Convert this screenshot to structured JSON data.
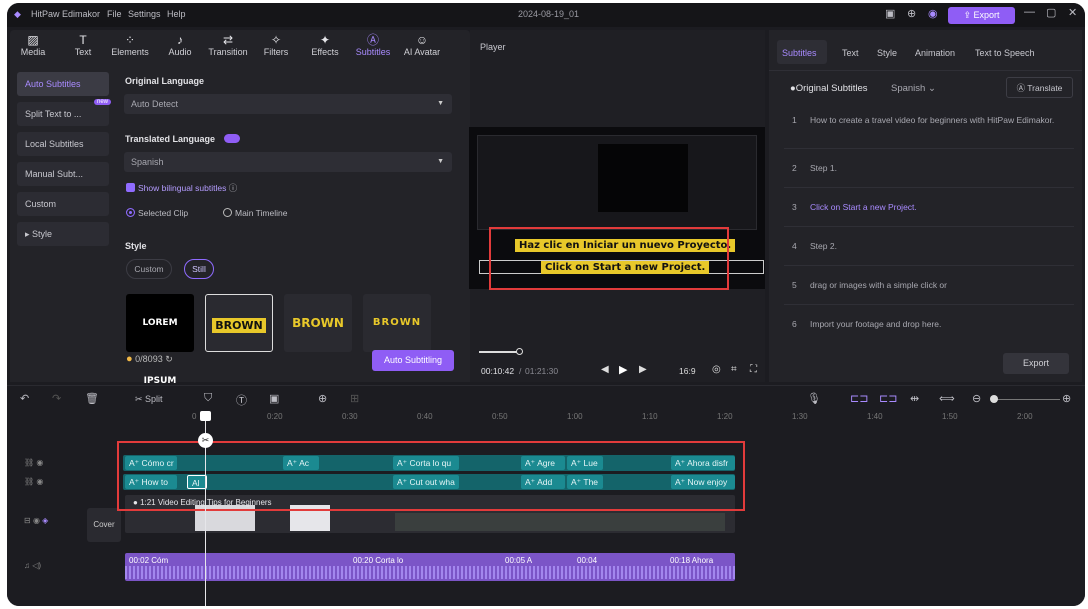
{
  "app": {
    "name": "HitPaw Edimakor",
    "menus": [
      "File",
      "Settings",
      "Help"
    ],
    "project_title": "2024-08-19_01",
    "export_label": "Export"
  },
  "toolbar": [
    {
      "label": "Media",
      "icon": "media-icon"
    },
    {
      "label": "Text",
      "icon": "text-icon"
    },
    {
      "label": "Elements",
      "icon": "elements-icon"
    },
    {
      "label": "Audio",
      "icon": "audio-icon"
    },
    {
      "label": "Transition",
      "icon": "transition-icon"
    },
    {
      "label": "Filters",
      "icon": "filters-icon"
    },
    {
      "label": "Effects",
      "icon": "effects-icon"
    },
    {
      "label": "Subtitles",
      "icon": "subtitles-icon",
      "active": true
    },
    {
      "label": "AI Avatar",
      "icon": "ai-avatar-icon"
    }
  ],
  "sidenav": {
    "items": [
      "Auto Subtitles",
      "Split Text to ...",
      "Local Subtitles",
      "Manual Subt...",
      "Custom",
      "Style"
    ],
    "new_badge": "new"
  },
  "panel": {
    "original_language_label": "Original Language",
    "original_language_value": "Auto Detect",
    "translated_language_label": "Translated Language",
    "translated_language_value": "Spanish",
    "bilingual_label": "Show bilingual subtitles",
    "scope_selected": "Selected Clip",
    "scope_main": "Main Timeline",
    "style_label": "Style",
    "style_custom": "Custom",
    "style_still": "Still",
    "style_cards": [
      "LOREM IPSUM",
      "BROWN",
      "BROWN",
      "BROWN"
    ],
    "credits": "0/8093",
    "auto_button": "Auto Subtitling"
  },
  "player": {
    "header": "Player",
    "subtitle_translated": "Haz clic en Iniciar un nuevo Proyecto.",
    "subtitle_original": "Click on Start a new Project.",
    "time_current": "00:10:42",
    "time_total": "01:21:30",
    "aspect": "16:9"
  },
  "right": {
    "tabs": [
      "Subtitles",
      "Text",
      "Style",
      "Animation",
      "Text to Speech"
    ],
    "original_label": "Original Subtitles",
    "language": "Spanish",
    "translate_button": "Translate",
    "rows": [
      {
        "n": "1",
        "text": "How to create a travel video for beginners with HitPaw Edimakor."
      },
      {
        "n": "2",
        "text": "Step 1."
      },
      {
        "n": "3",
        "text": "Click on Start a new Project."
      },
      {
        "n": "4",
        "text": "Step 2."
      },
      {
        "n": "5",
        "text": "drag or images with a simple click or"
      },
      {
        "n": "6",
        "text": "Import your footage and drop here."
      }
    ],
    "export_button": "Export"
  },
  "timeline": {
    "split_label": "Split",
    "ruler": [
      "0",
      "0:20",
      "0:30",
      "0:40",
      "0:50",
      "1:00",
      "1:10",
      "1:20",
      "1:30",
      "1:40",
      "1:50",
      "2:00"
    ],
    "cover_label": "Cover",
    "video_clip_title": "1:21 Video Editing Tips for Beginners",
    "sub_track_1": [
      "Cómo cr",
      "Ac",
      "Corta lo qu",
      "Agre",
      "Lue",
      "Ahora disfr"
    ],
    "sub_track_2": [
      "How to",
      "Al",
      "Cut out wha",
      "Add",
      "The",
      "Now enjoy"
    ],
    "audio_labels": [
      "00:02 Cóm",
      "00:20 Corta lo",
      "00:05 A",
      "00:04",
      "00:18 Ahora"
    ]
  }
}
